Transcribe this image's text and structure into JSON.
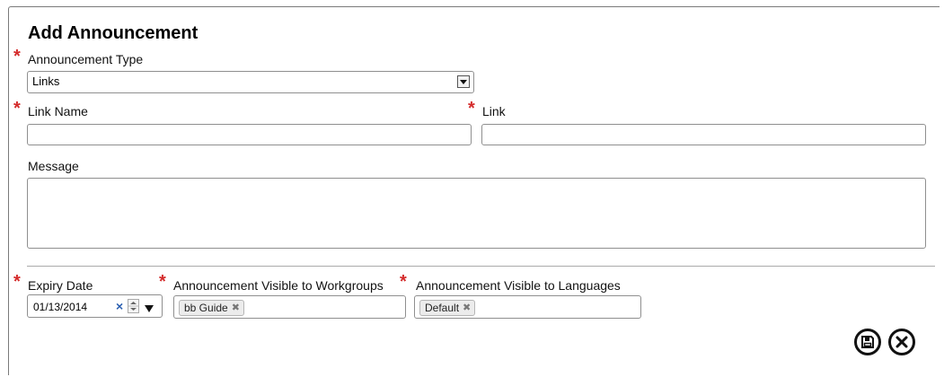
{
  "dialog": {
    "title": "Add Announcement"
  },
  "form": {
    "required_mark": "*",
    "announcement_type": {
      "label": "Announcement Type",
      "value": "Links"
    },
    "link_name": {
      "label": "Link Name",
      "value": ""
    },
    "link": {
      "label": "Link",
      "value": ""
    },
    "message": {
      "label": "Message",
      "value": ""
    },
    "expiry_date": {
      "label": "Expiry Date",
      "value": "01/13/2014"
    },
    "workgroups": {
      "label": "Announcement Visible to Workgroups",
      "tags": [
        "bb Guide"
      ]
    },
    "languages": {
      "label": "Announcement Visible to Languages",
      "tags": [
        "Default"
      ]
    }
  },
  "actions": {
    "save_icon": "save-icon",
    "cancel_icon": "cancel-icon"
  }
}
